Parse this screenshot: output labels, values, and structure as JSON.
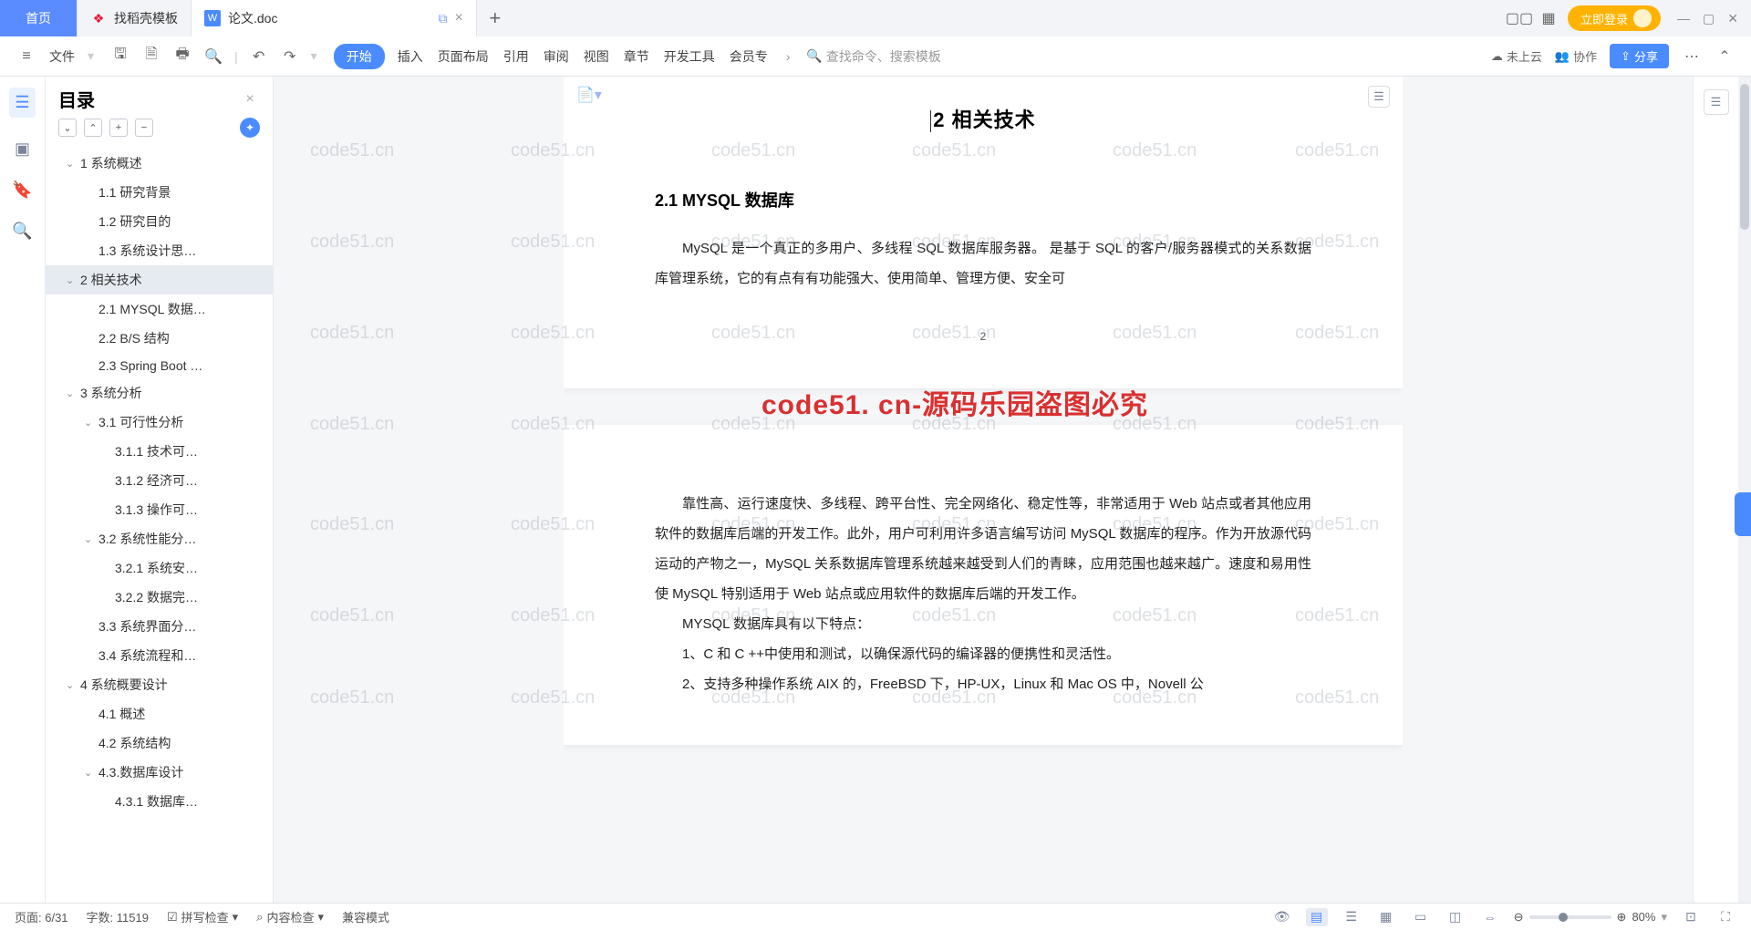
{
  "tabs": {
    "home": "首页",
    "t1": "找稻壳模板",
    "t2": "论文.doc",
    "login": "立即登录"
  },
  "toolbar": {
    "menu": "文件",
    "ribbons": [
      "开始",
      "插入",
      "页面布局",
      "引用",
      "审阅",
      "视图",
      "章节",
      "开发工具",
      "会员专"
    ],
    "search_hint": "查找命令、搜索模板",
    "not_uploaded": "未上云",
    "collab": "协作",
    "share": "分享"
  },
  "sidebar": {
    "title": "目录",
    "toc": [
      {
        "lvl": 1,
        "label": "1 系统概述",
        "exp": true
      },
      {
        "lvl": 2,
        "label": "1.1 研究背景"
      },
      {
        "lvl": 2,
        "label": "1.2 研究目的"
      },
      {
        "lvl": 2,
        "label": "1.3 系统设计思…"
      },
      {
        "lvl": 1,
        "label": "2 相关技术",
        "exp": true,
        "sel": true
      },
      {
        "lvl": 2,
        "label": "2.1 MYSQL 数据…"
      },
      {
        "lvl": 2,
        "label": "2.2 B/S 结构"
      },
      {
        "lvl": 2,
        "label": "2.3 Spring Boot …"
      },
      {
        "lvl": 1,
        "label": "3 系统分析",
        "exp": true
      },
      {
        "lvl": 2,
        "label": "3.1 可行性分析",
        "exp": true
      },
      {
        "lvl": 3,
        "label": "3.1.1 技术可…"
      },
      {
        "lvl": 3,
        "label": "3.1.2 经济可…"
      },
      {
        "lvl": 3,
        "label": "3.1.3 操作可…"
      },
      {
        "lvl": 2,
        "label": "3.2 系统性能分…",
        "exp": true
      },
      {
        "lvl": 3,
        "label": "3.2.1 系统安…"
      },
      {
        "lvl": 3,
        "label": "3.2.2 数据完…"
      },
      {
        "lvl": 2,
        "label": "3.3 系统界面分…"
      },
      {
        "lvl": 2,
        "label": "3.4 系统流程和…"
      },
      {
        "lvl": 1,
        "label": "4 系统概要设计",
        "exp": true
      },
      {
        "lvl": 2,
        "label": "4.1 概述"
      },
      {
        "lvl": 2,
        "label": "4.2 系统结构"
      },
      {
        "lvl": 2,
        "label": "4.3.数据库设计",
        "exp": true
      },
      {
        "lvl": 3,
        "label": "4.3.1 数据库…"
      }
    ]
  },
  "doc": {
    "chapter_title": "相关技术",
    "chapter_prefix": "2",
    "section_title": "2.1 MYSQL 数据库",
    "p1": "MySQL 是一个真正的多用户、多线程 SQL 数据库服务器。 是基于 SQL 的客户/服务器模式的关系数据库管理系统，它的有点有有功能强大、使用简单、管理方便、安全可",
    "page_num": "2",
    "p2": "靠性高、运行速度快、多线程、跨平台性、完全网络化、稳定性等，非常适用于 Web 站点或者其他应用软件的数据库后端的开发工作。此外，用户可利用许多语言编写访问 MySQL 数据库的程序。作为开放源代码运动的产物之一，MySQL 关系数据库管理系统越来越受到人们的青睐，应用范围也越来越广。速度和易用性使 MySQL 特别适用于 Web 站点或应用软件的数据库后端的开发工作。",
    "p3": "MYSQL 数据库具有以下特点：",
    "p4": "1、C 和 C ++中使用和测试，以确保源代码的编译器的便携性和灵活性。",
    "p5": "2、支持多种操作系统 AIX 的，FreeBSD 下，HP-UX，Linux 和 Mac OS 中，Novell 公"
  },
  "overlay_text": "code51. cn-源码乐园盗图必究",
  "watermark": "code51.cn",
  "status": {
    "page": "页面: 6/31",
    "words": "字数: 11519",
    "spell": "拼写检查",
    "content": "内容检查",
    "compat": "兼容模式",
    "zoom": "80%"
  }
}
